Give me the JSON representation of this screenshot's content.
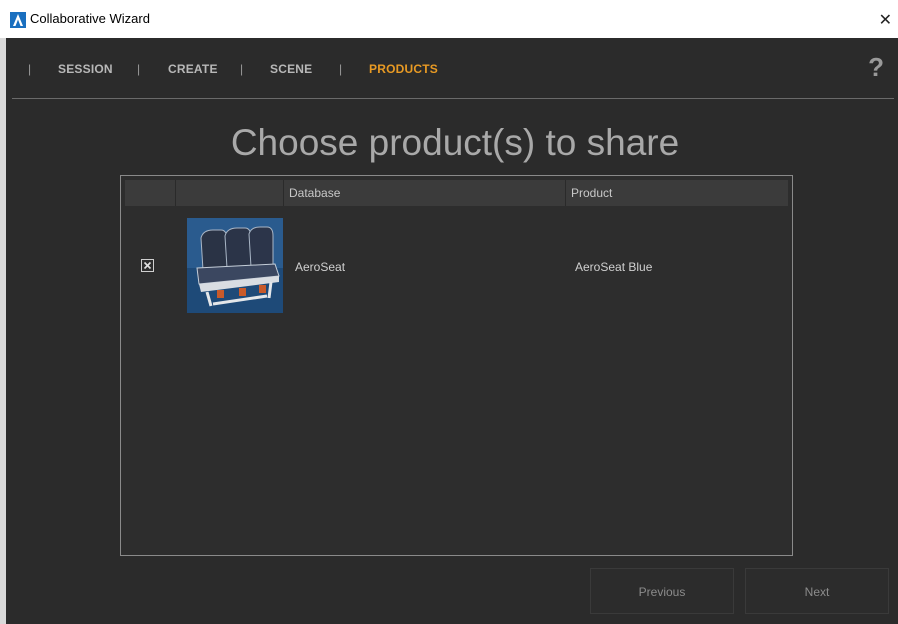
{
  "window": {
    "title": "Collaborative Wizard"
  },
  "nav": {
    "separator": "|",
    "items": [
      {
        "label": "SESSION",
        "active": false
      },
      {
        "label": "CREATE",
        "active": false
      },
      {
        "label": "SCENE",
        "active": false
      },
      {
        "label": "PRODUCTS",
        "active": true
      }
    ],
    "help": "?",
    "active_color": "#e89a24"
  },
  "heading": "Choose product(s) to share",
  "table": {
    "columns": [
      "",
      "",
      "Database",
      "Product"
    ],
    "rows": [
      {
        "checked": true,
        "thumbnail": "aircraft-seat-thumbnail",
        "database": "AeroSeat",
        "product": "AeroSeat Blue"
      }
    ]
  },
  "buttons": {
    "previous": "Previous",
    "next": "Next"
  }
}
